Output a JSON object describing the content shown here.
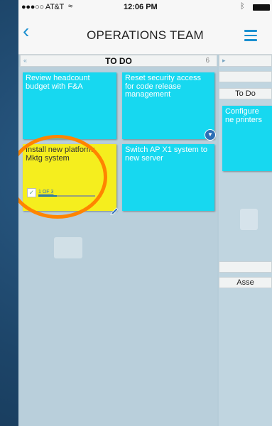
{
  "status_bar": {
    "carrier": "●●●○○ AT&T",
    "wifi": "≈",
    "time": "12:06 PM",
    "bluetooth": "ᛒ"
  },
  "nav": {
    "back_icon": "chevron-left",
    "title": "OPERATIONS TEAM",
    "menu_icon": "hamburger"
  },
  "columns": [
    {
      "mark": "«",
      "name": "TO DO",
      "count": "6"
    },
    {
      "mark": "▸",
      "name": "",
      "count": ""
    }
  ],
  "cards": [
    {
      "text": "Review headcount budget with F&A",
      "color": "#17d8f0"
    },
    {
      "text": "Reset security access for code release management",
      "color": "#17d8f0",
      "has_badge": true
    },
    {
      "text": "Install new platform: Mktg system",
      "color": "#f5ee1e",
      "checklist": {
        "label": "1 OF 3",
        "fraction": 0.33
      },
      "highlighted": true
    },
    {
      "text": "Switch AP X1 system to new server",
      "color": "#17d8f0"
    }
  ],
  "right_column": {
    "swimlane_label": "To Do",
    "card_text": "Configure ne printers",
    "lower_label": "Asse"
  },
  "colors": {
    "accent": "#1a8fd0",
    "highlight_ring": "#ff8400",
    "card_cyan": "#17d8f0",
    "card_yellow": "#f5ee1e"
  }
}
